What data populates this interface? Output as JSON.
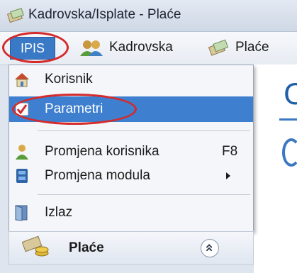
{
  "window": {
    "title": "Kadrovska/Isplate - Plaće"
  },
  "menubar": {
    "items": [
      {
        "label": "IPIS",
        "icon": "none",
        "active": true
      },
      {
        "label": "Kadrovska",
        "icon": "users-icon"
      },
      {
        "label": "Plaće",
        "icon": "money-icon"
      }
    ]
  },
  "dropdown": {
    "items": [
      {
        "label": "Korisnik",
        "icon": "home-icon"
      },
      {
        "label": "Parametri",
        "icon": "checkbox-icon",
        "selected": true
      },
      {
        "label": "Promjena korisnika",
        "icon": "user-icon",
        "shortcut": "F8"
      },
      {
        "label": "Promjena modula",
        "icon": "module-icon",
        "submenu": true
      },
      {
        "label": "Izlaz",
        "icon": "exit-icon"
      }
    ]
  },
  "panel": {
    "label": "Plaće",
    "icon": "coins-icon"
  },
  "content": {
    "heading_fragment": "C"
  },
  "colors": {
    "highlight": "#3e7fcf",
    "annotation": "#d42a2a",
    "menu_active": "#3a79c6"
  }
}
